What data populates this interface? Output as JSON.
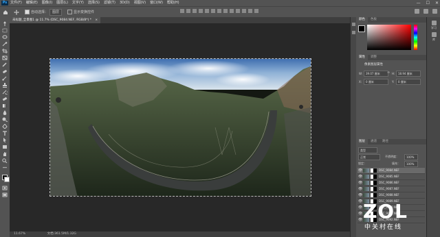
{
  "menubar": {
    "logo": "Ps",
    "items": [
      "文件(F)",
      "编辑(E)",
      "图像(I)",
      "图层(L)",
      "文字(Y)",
      "选择(S)",
      "滤镜(T)",
      "3D(D)",
      "视图(V)",
      "窗口(W)",
      "帮助(H)"
    ],
    "window_controls": [
      "—",
      "☐",
      "✕"
    ]
  },
  "options": {
    "auto_select_label": "自动选择：",
    "auto_select_value": "图层",
    "transform_label": "显示变换控件"
  },
  "document": {
    "tab_title": "未标题_全景图1 @ 11.7% (DSC_9084.NEF, RGB/8*) *",
    "close": "×"
  },
  "status": {
    "zoom": "11.67%",
    "info": "文档:361.5M/1.32G"
  },
  "color_panel": {
    "tabs": [
      "颜色",
      "色板"
    ],
    "hue_color": "#ff0000"
  },
  "properties_panel": {
    "tabs": [
      "属性",
      "调整"
    ],
    "section": "像素图层属性",
    "w_label": "W:",
    "w_value": "39.07 厘米",
    "h_label": "H:",
    "h_value": "18.94 厘米",
    "x_label": "X:",
    "x_value": "0 厘米",
    "y_label": "Y:",
    "y_value": "0 厘米"
  },
  "layers_panel": {
    "tabs": [
      "图层",
      "通道",
      "路径"
    ],
    "filter_label": "类型",
    "blend_mode": "正常",
    "opacity_label": "不透明度：",
    "opacity_value": "100%",
    "lock_label": "锁定：",
    "fill_label": "填充：",
    "fill_value": "100%",
    "layers": [
      {
        "name": "DSC_9084.NEF",
        "selected": true
      },
      {
        "name": "DSC_9085.NEF",
        "selected": false
      },
      {
        "name": "DSC_9086.NEF",
        "selected": false
      },
      {
        "name": "DSC_9087.NEF",
        "selected": false
      },
      {
        "name": "DSC_9088.NEF",
        "selected": false
      },
      {
        "name": "DSC_9089.NEF",
        "selected": false
      },
      {
        "name": "DSC_9090.NEF",
        "selected": false
      },
      {
        "name": "DSC_9091.NEF",
        "selected": false
      },
      {
        "name": "DSC_9092.NEF",
        "selected": false
      }
    ]
  },
  "right_dock": {
    "items": [
      "学习",
      "库"
    ]
  },
  "watermark": {
    "logo": "ZOL",
    "subtitle": "中关村在线"
  }
}
